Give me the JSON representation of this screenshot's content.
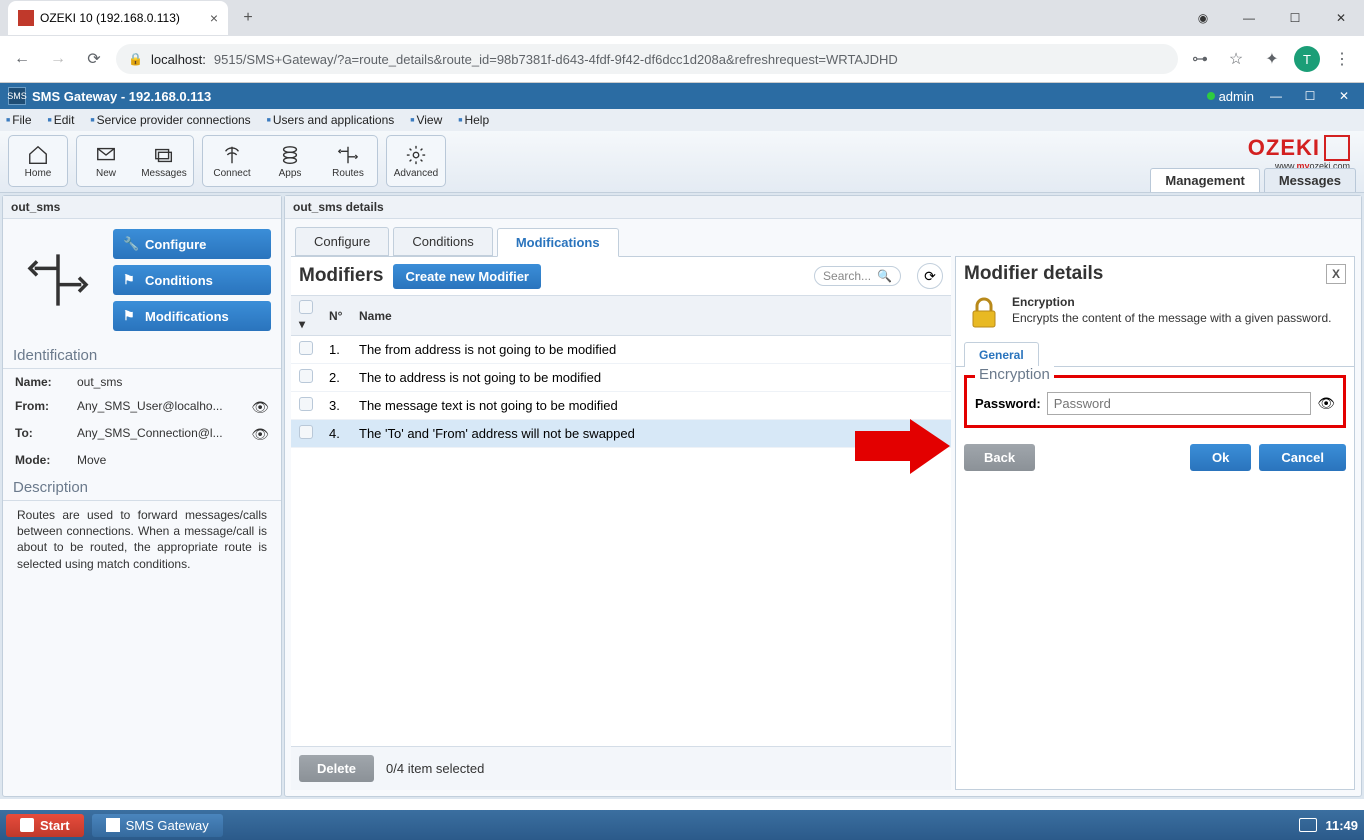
{
  "browser": {
    "tab_title": "OZEKI 10 (192.168.0.113)",
    "url_host": "localhost:",
    "url_path": "9515/SMS+Gateway/?a=route_details&route_id=98b7381f-d643-4fdf-9f42-df6dcc1d208a&refreshrequest=WRTAJDHD",
    "avatar_letter": "T"
  },
  "app_header": {
    "title": "SMS Gateway - 192.168.0.113",
    "user": "admin"
  },
  "menubar": [
    "File",
    "Edit",
    "Service provider connections",
    "Users and applications",
    "View",
    "Help"
  ],
  "toolbar": {
    "buttons": [
      "Home",
      "New",
      "Messages",
      "Connect",
      "Apps",
      "Routes",
      "Advanced"
    ],
    "logo": "OZEKI",
    "logo_sub_pre": "www.",
    "logo_sub_mid": "my",
    "logo_sub_post": "ozeki.com"
  },
  "top_tabs": {
    "management": "Management",
    "messages": "Messages"
  },
  "left_panel": {
    "title": "out_sms",
    "buttons": {
      "configure": "Configure",
      "conditions": "Conditions",
      "modifications": "Modifications"
    },
    "identification_h": "Identification",
    "id": {
      "name_k": "Name:",
      "name_v": "out_sms",
      "from_k": "From:",
      "from_v": "Any_SMS_User@localho...",
      "to_k": "To:",
      "to_v": "Any_SMS_Connection@l...",
      "mode_k": "Mode:",
      "mode_v": "Move"
    },
    "description_h": "Description",
    "description_text": "Routes are used to forward messages/calls between connections. When a message/call is about to be routed, the appropriate route is selected using match conditions."
  },
  "right_panel": {
    "title": "out_sms details",
    "tabs": {
      "configure": "Configure",
      "conditions": "Conditions",
      "modifications": "Modifications"
    },
    "modifiers_h": "Modifiers",
    "create_btn": "Create new Modifier",
    "search_placeholder": "Search...",
    "cols": {
      "num": "N°",
      "name": "Name"
    },
    "rows": [
      {
        "n": "1.",
        "name": "The from address is not going to be modified"
      },
      {
        "n": "2.",
        "name": "The to address is not going to be modified"
      },
      {
        "n": "3.",
        "name": "The message text is not going to be modified"
      },
      {
        "n": "4.",
        "name": "The 'To' and 'From' address will not be swapped"
      }
    ],
    "delete_btn": "Delete",
    "footer_text": "0/4 item selected"
  },
  "detail": {
    "title": "Modifier details",
    "name": "Encryption",
    "desc": "Encrypts the content of the message with a given password.",
    "sub_tab": "General",
    "group_legend": "Encryption",
    "password_label": "Password:",
    "password_placeholder": "Password",
    "back": "Back",
    "ok": "Ok",
    "cancel": "Cancel"
  },
  "taskbar": {
    "start": "Start",
    "app": "SMS Gateway",
    "time": "11:49"
  }
}
